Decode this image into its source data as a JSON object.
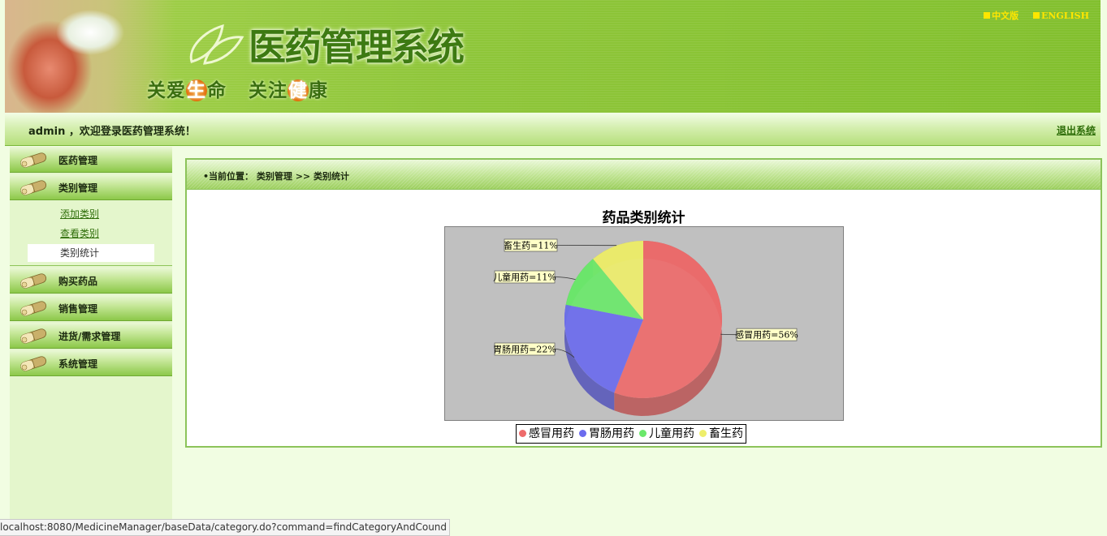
{
  "header": {
    "title": "医药管理系统",
    "slogan_part1": "关爱",
    "slogan_hl1": "生",
    "slogan_part2": "命",
    "slogan_part3": "关注",
    "slogan_hl2": "健",
    "slogan_part4": "康",
    "lang_cn": "中文版",
    "lang_en": "ENGLISH",
    "accent_color": "#8fc63a",
    "highlight_color": "#f28a1e"
  },
  "welcome": {
    "text": "admin ，欢迎登录医药管理系统！",
    "logout": "退出系统"
  },
  "sidebar": {
    "items": [
      {
        "label": "医药管理"
      },
      {
        "label": "类别管理"
      },
      {
        "label": "购买药品"
      },
      {
        "label": "销售管理"
      },
      {
        "label": "进货/需求管理"
      },
      {
        "label": "系统管理"
      }
    ],
    "submenu": [
      {
        "label": "添加类别"
      },
      {
        "label": "查看类别"
      },
      {
        "label": "类别统计",
        "active": true
      }
    ]
  },
  "breadcrumb": "•当前位置： 类别管理 >> 类别统计",
  "chart_data": {
    "type": "pie",
    "title": "药品类别统计",
    "categories": [
      "感冒用药",
      "胃肠用药",
      "儿童用药",
      "畜生药"
    ],
    "values": [
      56,
      22,
      11,
      11
    ],
    "labels": [
      "感冒用药=56%",
      "胃肠用药=22%",
      "儿童用药=11%",
      "畜生药=11%"
    ],
    "colors": [
      "#ee6b6b",
      "#6b6bee",
      "#6be86b",
      "#eeee6b"
    ],
    "legend": "bottom-center",
    "plot_background": "#c0c0c0",
    "style": "3d"
  },
  "status_bar": "localhost:8080/MedicineManager/baseData/category.do?command=findCategoryAndCound"
}
